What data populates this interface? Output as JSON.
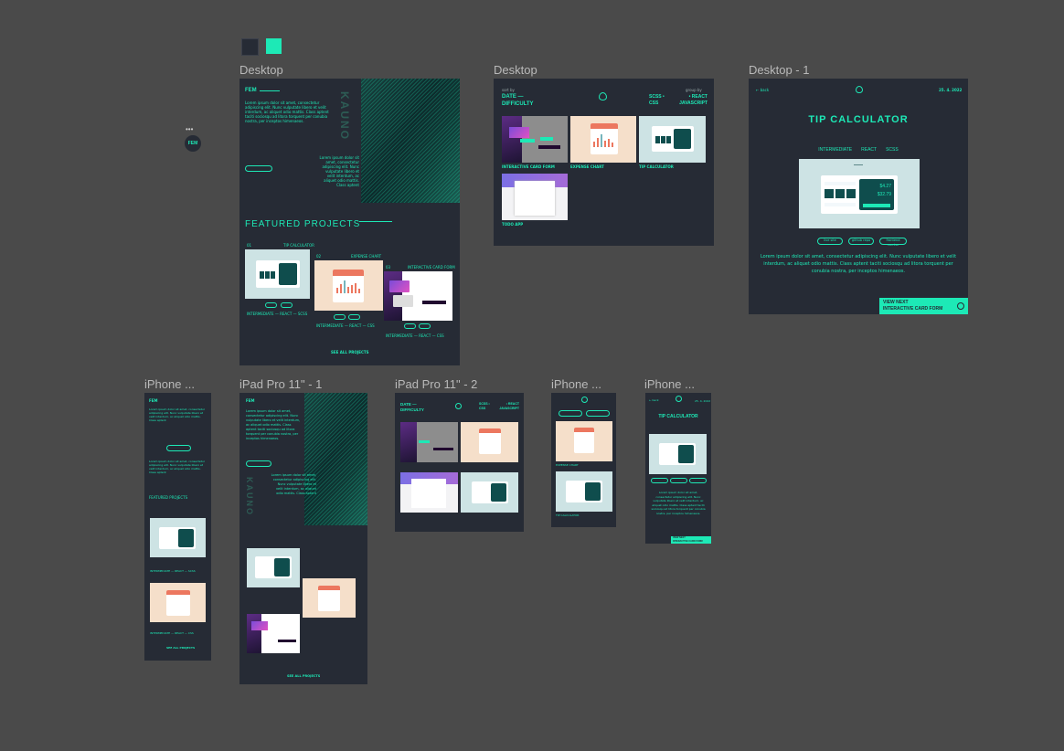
{
  "canvas": {
    "swatches": [
      "#262b35",
      "#1de9b6"
    ],
    "avatar_label": "FEM",
    "avatar_dots": "•••"
  },
  "frames": {
    "desktop_home": {
      "label": "Desktop",
      "logo": "FEM",
      "intro": "Lorem ipsum dolor sit amet, consectetur adipiscing elit. Nunc vulputate libero et velit interdum, ac aliquet odio mattis. Class aptent taciti sociosqu ad litora torquent per conubia nostra, per inceptos himenaeos.",
      "intro2": "Lorem ipsum dolor sit amet, consectetur adipiscing elit. Nunc vulputate libero et velit interdum, ac aliquet odio mattis. Class aptent",
      "vertical_title": "KAUNO",
      "featured_title": "FEATURED PROJECTS",
      "projects": [
        {
          "num": "01",
          "name": "TIP CALCULATOR",
          "tags": "INTERMEDIATE — REACT — SCSS"
        },
        {
          "num": "02",
          "name": "EXPENSE CHART",
          "tags": "INTERMEDIATE — REACT — CSS"
        },
        {
          "num": "03",
          "name": "INTERACTIVE CARD FORM",
          "tags": "INTERMEDIATE — REACT — CSS"
        }
      ],
      "see_all": "SEE ALL PROJECTS"
    },
    "desktop_projects": {
      "label": "Desktop",
      "sort_by": "sort by",
      "sort_value": "DATE — DIFFICULTY",
      "group_by": "group by",
      "group_left": "SCSS • CSS",
      "group_right": "• REACT JAVASCRIPT",
      "cards": [
        "INTERACTIVE CARD FORM",
        "EXPENSE CHART",
        "TIP CALCULATOR",
        "TODO APP"
      ]
    },
    "desktop_detail": {
      "label": "Desktop - 1",
      "back": "← back",
      "date": "25. 4. 2022",
      "title": "TIP CALCULATOR",
      "tags": [
        "INTERMEDIATE",
        "REACT",
        "SCSS"
      ],
      "amounts": [
        "$4.27",
        "$32.79"
      ],
      "links": [
        "live site",
        "github repo",
        "frontend mentor"
      ],
      "description": "Lorem ipsum dolor sit amet, consectetur adipiscing elit. Nunc vulputate libero et velit interdum, ac aliquet odio mattis. Class aptent taciti sociosqu ad litora torquent per conubia nostra, per inceptos himenaeos.",
      "next_label": "VIEW NEXT",
      "next_project": "INTERACTIVE CARD FORM"
    },
    "iphone_home": {
      "label": "iPhone ...",
      "featured": "FEATURED PROJECTS",
      "see_all": "SEE ALL PROJECTS"
    },
    "ipad_home": {
      "label": "iPad Pro 11\" - 1",
      "see_all": "SEE ALL PROJECTS"
    },
    "ipad_projects": {
      "label": "iPad Pro 11\" - 2"
    },
    "iphone_projects": {
      "label": "iPhone ..."
    },
    "iphone_detail": {
      "label": "iPhone ...",
      "title": "TIP CALCULATOR"
    }
  }
}
